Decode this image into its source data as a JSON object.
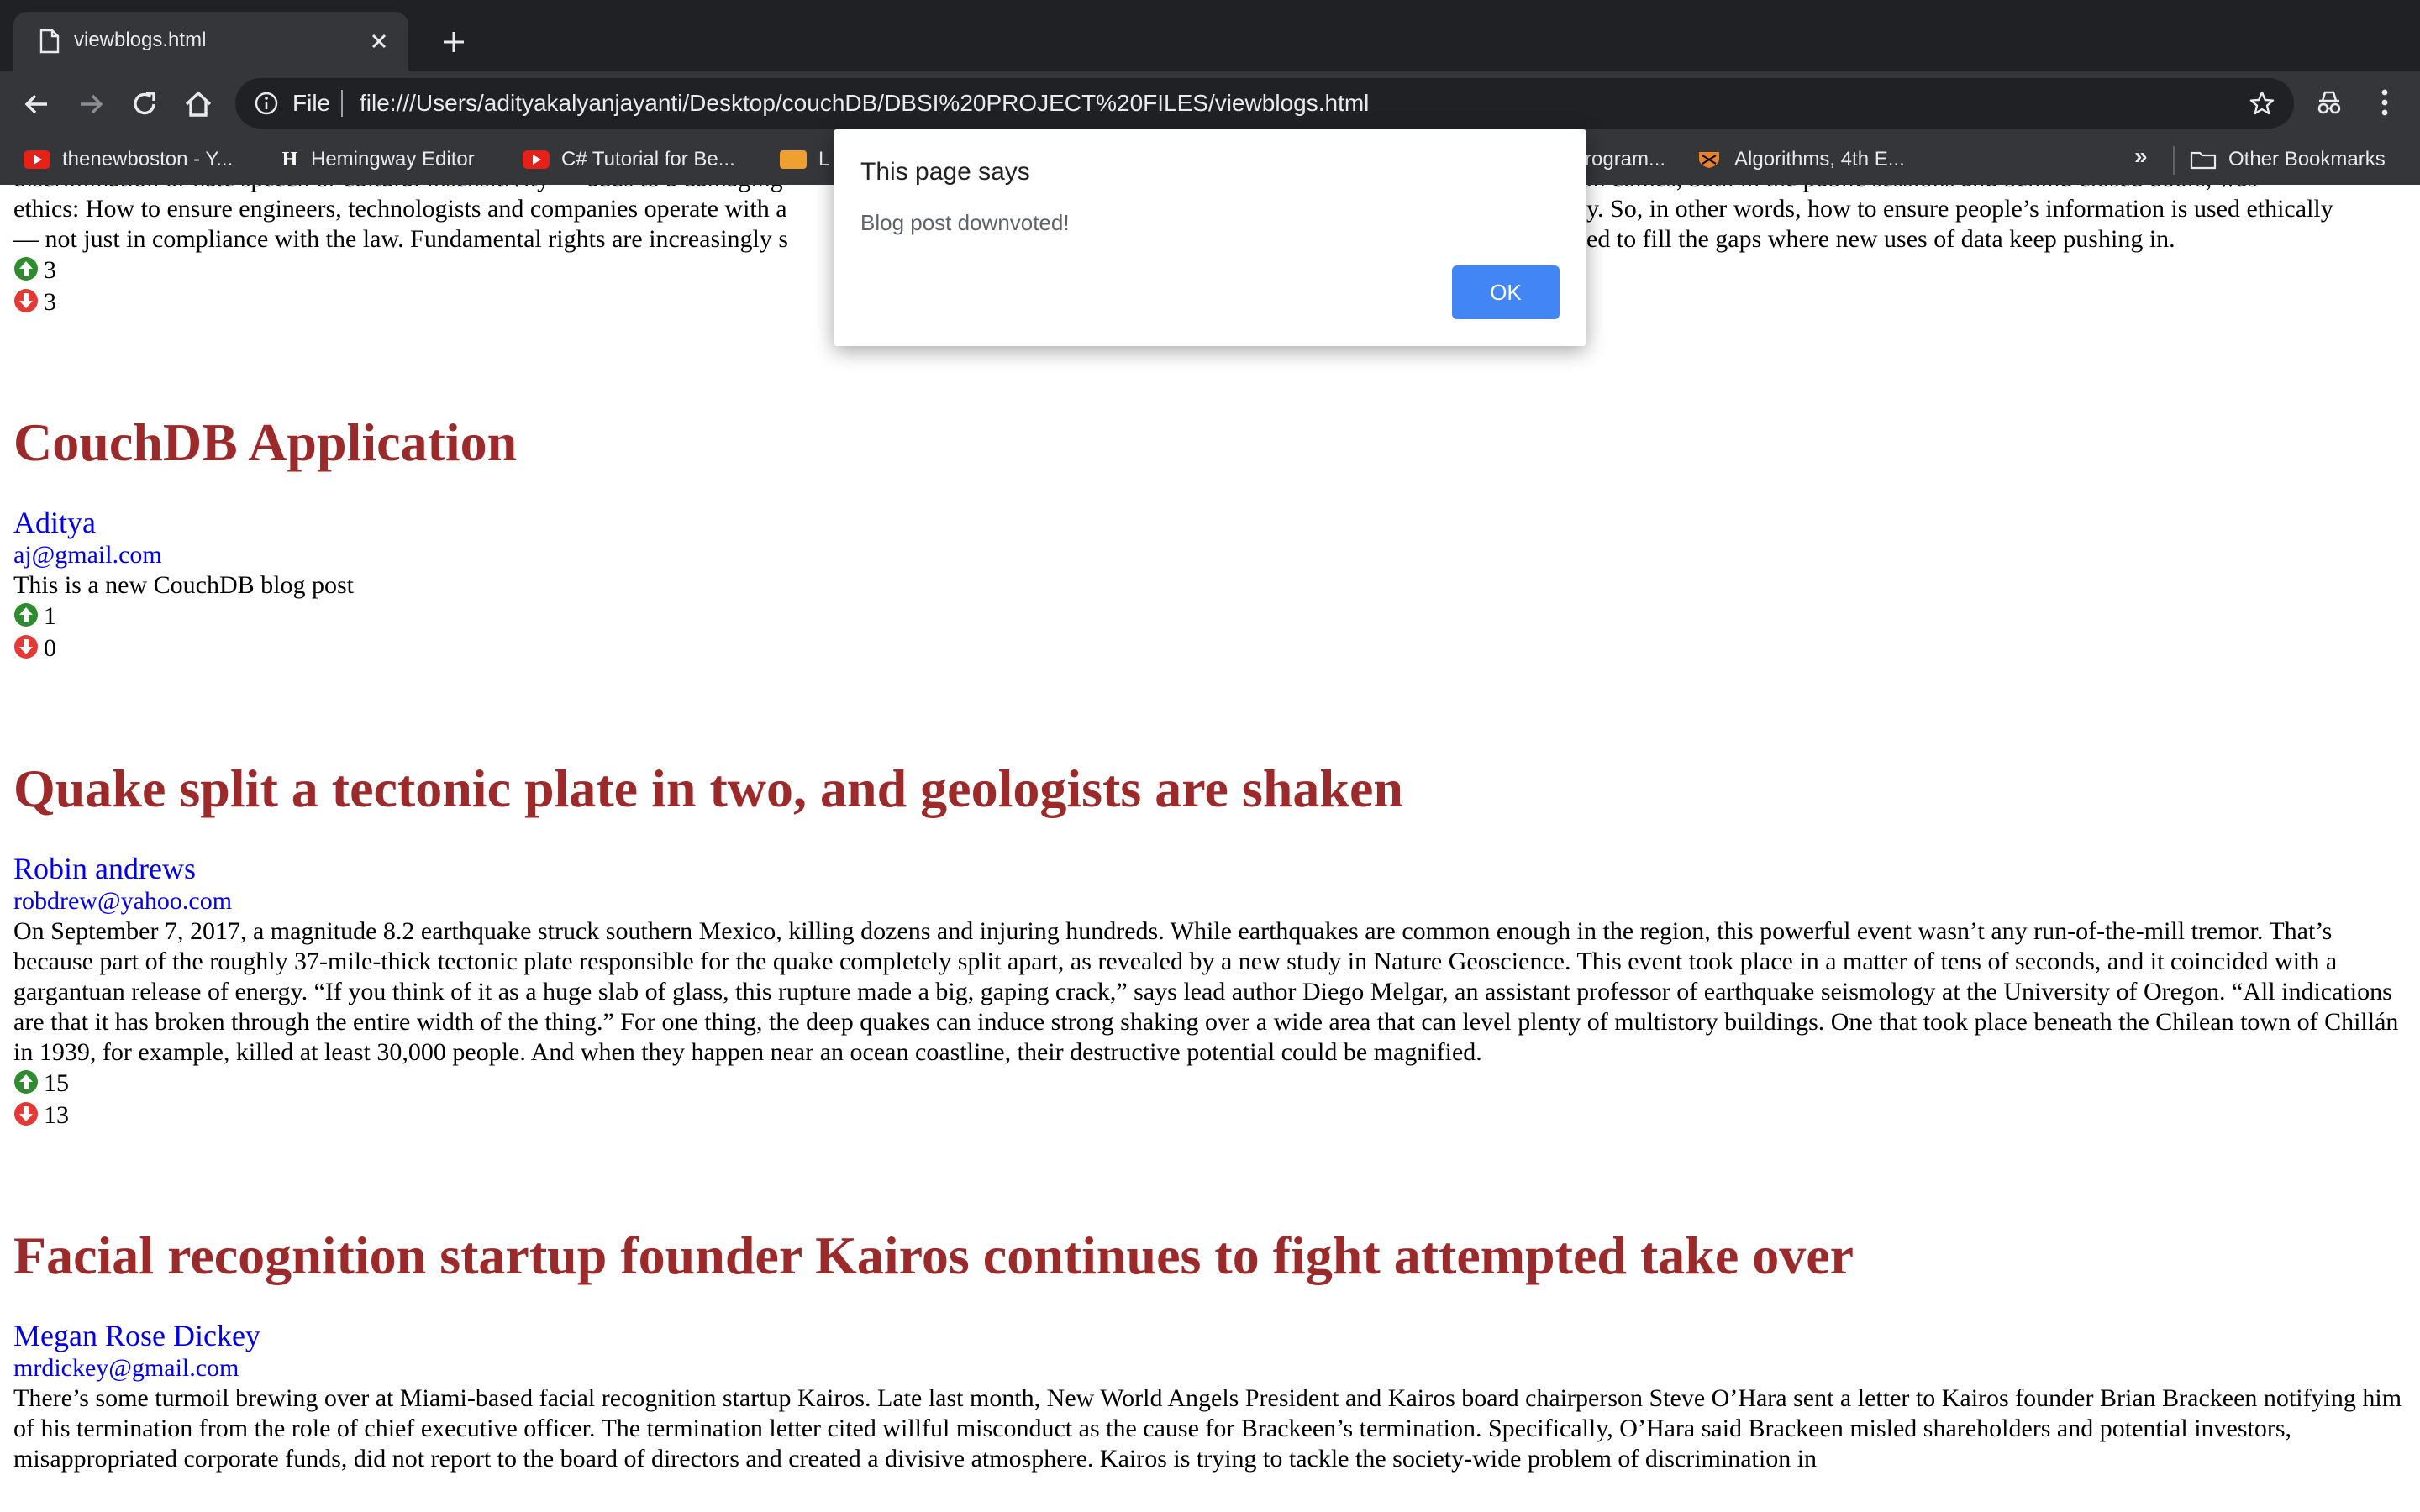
{
  "browser": {
    "tab_title": "viewblogs.html",
    "scheme_label": "File",
    "url": "file:///Users/adityakalyanjayanti/Desktop/couchDB/DBSI%20PROJECT%20FILES/viewblogs.html",
    "bookmarks": [
      {
        "label": "thenewboston - Y...",
        "icon": "youtube-icon"
      },
      {
        "label": "Hemingway Editor",
        "icon": "hemingway-icon"
      },
      {
        "label": "C# Tutorial for Be...",
        "icon": "youtube-icon"
      },
      {
        "label": "L",
        "icon": "bookmark-icon"
      },
      {
        "label": "rogram...",
        "icon": ""
      },
      {
        "label": "Algorithms, 4th E...",
        "icon": "princeton-icon"
      }
    ],
    "overflow_label": "»",
    "other_bookmarks_label": "Other Bookmarks"
  },
  "alert": {
    "title": "This page says",
    "message": "Blog post downvoted!",
    "ok_label": "OK"
  },
  "partial_post": {
    "lines": [
      "discrimination or hate speech or cultural insensitivity — adds to a damaging",
      "ethics: How to ensure engineers, technologists and companies operate with a",
      "— not just in compliance with the law. Fundamental rights are increasingly s"
    ],
    "lines_right": [
      "tion comes, both in the public sessions and behind closed doors, was",
      "y. So, in other words, how to ensure people’s information is used ethically",
      "ed to fill the gaps where new uses of data keep pushing in."
    ],
    "upvotes": "3",
    "downvotes": "3"
  },
  "posts": [
    {
      "title": "CouchDB Application",
      "author": "Aditya",
      "email": "aj@gmail.com",
      "body": "This is a new CouchDB blog post",
      "upvotes": "1",
      "downvotes": "0"
    },
    {
      "title": "Quake split a tectonic plate in two, and geologists are shaken",
      "author": "Robin andrews",
      "email": "robdrew@yahoo.com",
      "body": "On September 7, 2017, a magnitude 8.2 earthquake struck southern Mexico, killing dozens and injuring hundreds. While earthquakes are common enough in the region, this powerful event wasn’t any run-of-the-mill tremor. That’s because part of the roughly 37-mile-thick tectonic plate responsible for the quake completely split apart, as revealed by a new study in Nature Geoscience. This event took place in a matter of tens of seconds, and it coincided with a gargantuan release of energy. “If you think of it as a huge slab of glass, this rupture made a big, gaping crack,” says lead author Diego Melgar, an assistant professor of earthquake seismology at the University of Oregon. “All indications are that it has broken through the entire width of the thing.” For one thing, the deep quakes can induce strong shaking over a wide area that can level plenty of multistory buildings. One that took place beneath the Chilean town of Chillán in 1939, for example, killed at least 30,000 people. And when they happen near an ocean coastline, their destructive potential could be magnified.",
      "upvotes": "15",
      "downvotes": "13"
    },
    {
      "title": "Facial recognition startup founder Kairos continues to fight attempted take over",
      "author": "Megan Rose Dickey",
      "email": "mrdickey@gmail.com",
      "body": "There’s some turmoil brewing over at Miami-based facial recognition startup Kairos. Late last month, New World Angels President and Kairos board chairperson Steve O’Hara sent a letter to Kairos founder Brian Brackeen notifying him of his termination from the role of chief executive officer. The termination letter cited willful misconduct as the cause for Brackeen’s termination. Specifically, O’Hara said Brackeen misled shareholders and potential investors, misappropriated corporate funds, did not report to the board of directors and created a divisive atmosphere. Kairos is trying to tackle the society-wide problem of discrimination in"
    }
  ]
}
